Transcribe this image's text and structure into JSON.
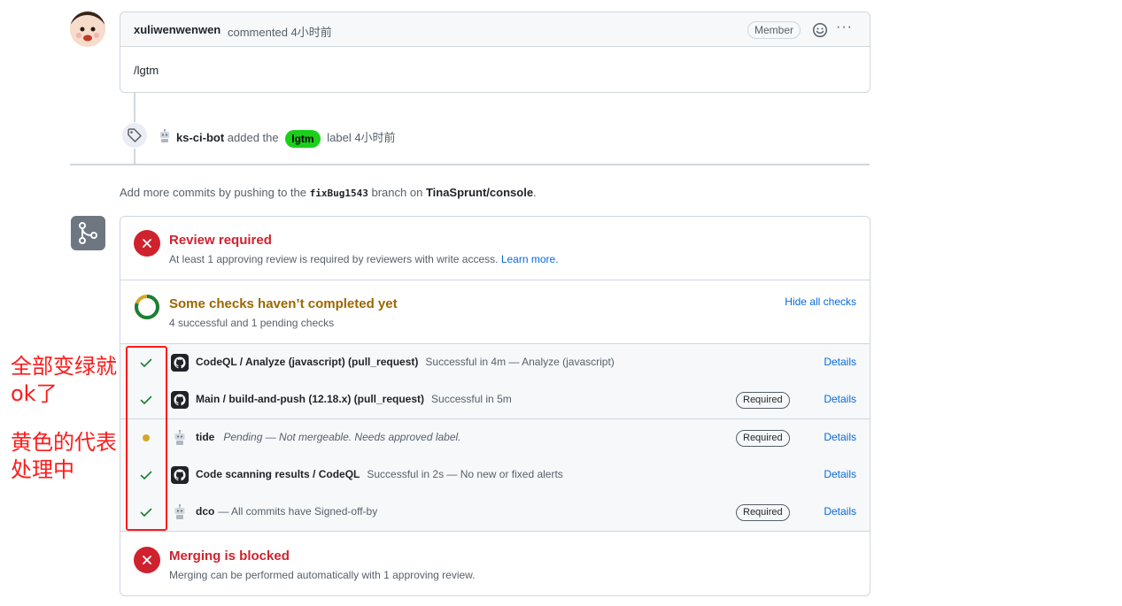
{
  "comment": {
    "author": "xuliwenwenwen",
    "action": "commented 4小时前",
    "badge": "Member",
    "body": "/lgtm",
    "more": "···"
  },
  "label_event": {
    "actor": "ks-ci-bot",
    "text_before": "added the",
    "label": "lgtm",
    "label_color": "#1ad01a",
    "text_after": "label 4小时前"
  },
  "push_note": {
    "prefix": "Add more commits by pushing to the",
    "branch": "fixBug1543",
    "middle": "branch on",
    "repo": "TinaSprunt/console",
    "suffix": "."
  },
  "review": {
    "title": "Review required",
    "subtitle": "At least 1 approving review is required by reviewers with write access.",
    "link": "Learn more."
  },
  "checks": {
    "title": "Some checks haven’t completed yet",
    "subtitle": "4 successful and 1 pending checks",
    "hide_label": "Hide all checks",
    "progress_fraction": 0.8,
    "rows": [
      {
        "status": "success",
        "app": "github-icon",
        "name": "CodeQL / Analyze (javascript) (pull_request)",
        "description": "Successful in 4m — Analyze (javascript)",
        "required": "",
        "details": "Details"
      },
      {
        "status": "success",
        "app": "github-icon",
        "name": "Main / build-and-push (12.18.x) (pull_request)",
        "description": "Successful in 5m",
        "required": "Required",
        "details": "Details"
      },
      {
        "status": "pending",
        "app": "bot-icon",
        "name": "tide",
        "description": "Pending — Not mergeable. Needs approved label.",
        "required": "Required",
        "details": "Details"
      },
      {
        "status": "success",
        "app": "github-icon",
        "name": "Code scanning results / CodeQL",
        "description": "Successful in 2s — No new or fixed alerts",
        "required": "",
        "details": "Details"
      },
      {
        "status": "success",
        "app": "bot-icon",
        "name": "dco",
        "description": "— All commits have Signed-off-by",
        "required": "Required",
        "details": "Details"
      }
    ]
  },
  "blocked": {
    "title": "Merging is blocked",
    "subtitle": "Merging can be performed automatically with 1 approving review."
  },
  "annotation": {
    "line1": "全部变绿就",
    "line2": "ok了",
    "line3": "黄色的代表",
    "line4": "处理中",
    "color": "#ff1a1a"
  },
  "colors": {
    "success": "#1a7f37",
    "pending": "#d4a72c",
    "danger": "#cf222e",
    "link": "#0969da"
  }
}
